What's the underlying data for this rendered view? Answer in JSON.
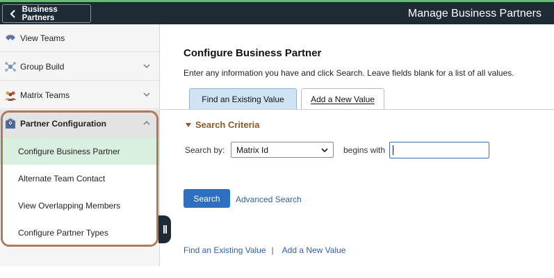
{
  "header": {
    "back_label": "Business Partners",
    "title": "Manage Business Partners"
  },
  "sidebar": {
    "items": [
      {
        "label": "View Teams",
        "icon": "teams-icon",
        "expandable": false
      },
      {
        "label": "Group Build",
        "icon": "group-build-icon",
        "expandable": true
      },
      {
        "label": "Matrix Teams",
        "icon": "matrix-teams-icon",
        "expandable": true
      },
      {
        "label": "Partner Configuration",
        "icon": "partner-config-icon",
        "expandable": true,
        "expanded": true
      }
    ],
    "sub_items": [
      {
        "label": "Configure Business Partner",
        "active": true
      },
      {
        "label": "Alternate Team Contact",
        "active": false
      },
      {
        "label": "View Overlapping Members",
        "active": false
      },
      {
        "label": "Configure Partner Types",
        "active": false
      }
    ]
  },
  "main": {
    "title": "Configure Business Partner",
    "instructions": "Enter any information you have and click Search. Leave fields blank for a list of all values.",
    "tabs": [
      {
        "label": "Find an Existing Value",
        "selected": true
      },
      {
        "label": "Add a New Value",
        "selected": false
      }
    ],
    "criteria_label": "Search Criteria",
    "search_by_label": "Search by:",
    "search_by_value": "Matrix Id",
    "operator_label": "begins with",
    "search_value": "",
    "search_button": "Search",
    "advanced_link": "Advanced Search",
    "bottom_links": [
      "Find an Existing Value",
      "Add a New Value"
    ],
    "bottom_sep": "|"
  },
  "colors": {
    "header_bg": "#1e2a34",
    "accent_green": "#5dc26a",
    "primary_button": "#2f6fbf",
    "link": "#2f5fa8",
    "criteria": "#8b5a2b",
    "highlight_border": "#b07a5a",
    "active_subitem": "#d9efe0",
    "selected_tab": "#cfe3f5"
  }
}
